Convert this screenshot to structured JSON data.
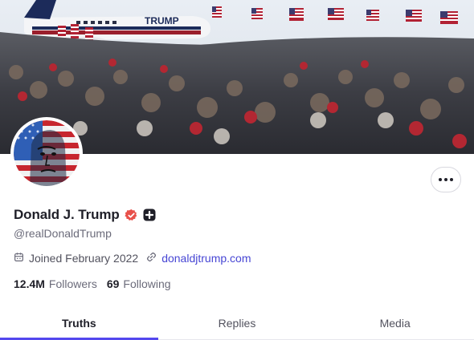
{
  "profile": {
    "display_name": "Donald J. Trump",
    "handle": "@realDonaldTrump",
    "joined": "Joined February 2022",
    "website": "donaldjtrump.com",
    "followers_count": "12.4M",
    "followers_label": "Followers",
    "following_count": "69",
    "following_label": "Following"
  },
  "banner": {
    "plane_text": "TRUMP"
  },
  "tabs": [
    {
      "label": "Truths",
      "active": true
    },
    {
      "label": "Replies",
      "active": false
    },
    {
      "label": "Media",
      "active": false
    }
  ],
  "icons": {
    "verified": "verified-badge-icon",
    "plus": "plus-badge-icon",
    "calendar": "calendar-icon",
    "link": "link-icon",
    "more": "more-dots-icon"
  },
  "colors": {
    "accent": "#5448ee",
    "link": "#4746d4",
    "verified": "#e8504a"
  }
}
